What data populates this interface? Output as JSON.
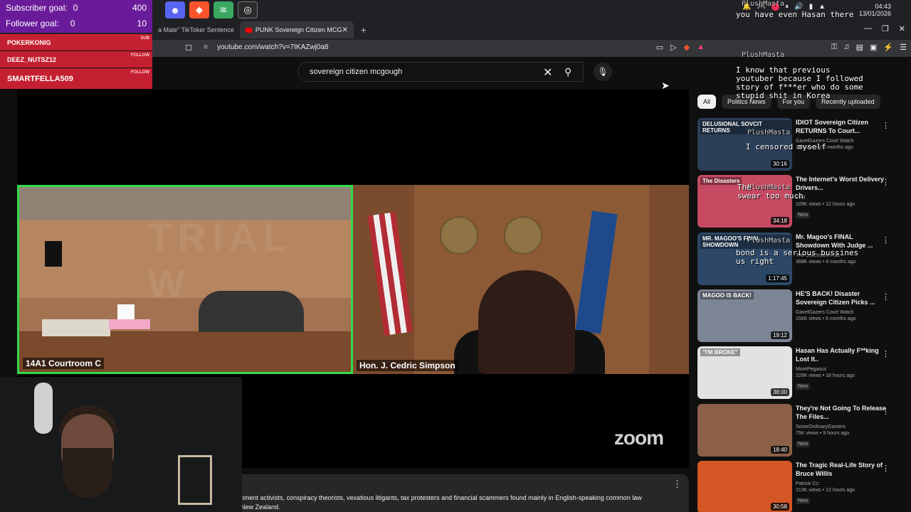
{
  "stream": {
    "goals": [
      {
        "label": "Subscriber goal:",
        "current": "0",
        "target": "400"
      },
      {
        "label": "Follower goal:",
        "current": "0",
        "target": "10"
      }
    ],
    "alerts": [
      {
        "name": "POKERKONIG",
        "tag": "SUB"
      },
      {
        "name": "DEEZ_NUTSZ12",
        "tag": "FOLLOW"
      },
      {
        "name": "SMARTFELLA509",
        "tag": "FOLLOW"
      }
    ],
    "chat": [
      {
        "user": "PlushMasta",
        "msg": "you have even Hasan there"
      },
      {
        "user": "PlushMasta",
        "msg": "I know that previous\nyoutuber because I followed\nstory of f***er who do some\nstupid shit in Korea"
      },
      {
        "user": "PlushMasta",
        "msg": "I censored myself"
      },
      {
        "user": "PlushMasta",
        "msg": "The\nswear too much"
      },
      {
        "user": "PlushMasta",
        "msg": "bond is a serious bussines\nus right"
      }
    ]
  },
  "browser": {
    "tabs": [
      {
        "label": "a Male\" TikToker Sentence"
      },
      {
        "label": "PUNK Sovereign Citizen MCG"
      }
    ],
    "new_tab": "+",
    "tab_close": "✕",
    "url_prefix": "≡",
    "url": "youtube.com/watch?v=7IKAZwj0a8",
    "window_controls": [
      "—",
      "❐",
      "✕"
    ],
    "clock": {
      "time": "04:43",
      "date": "13/01/2026"
    }
  },
  "youtube": {
    "search_query": "sovereign citizen mcgough",
    "clear_label": "✕",
    "search_icon": "⚲",
    "mic_icon": "🎙",
    "player": {
      "left_caption": "14A1 Courtroom C",
      "right_caption": "Hon. J. Cedric Simpson",
      "watermark": "TRIAL W",
      "brand": "zoom"
    },
    "description": "nment activists, conspiracy theorists, vexatious litigants, tax protesters and financial scammers found mainly in English-speaking common law\nNew Zealand.",
    "description_more": "⋮",
    "chips": [
      "All",
      "Politics News",
      "For you",
      "Recently uploaded"
    ],
    "active_chip": 0,
    "recommendations": [
      {
        "title": "IDIOT Sovereign Citizen RETURNS To Court...",
        "channel": "GavelGazers Court Watch",
        "meta": "16K views • 4 months ago",
        "duration": "30:16",
        "badge": "",
        "thumb_caption": "DELUSIONAL SOVCIT RETURNS",
        "color": "#2b3f59"
      },
      {
        "title": "The Internet's Worst Delivery Drivers...",
        "channel": "Zmil",
        "meta": "109K views • 12 hours ago",
        "duration": "34:18",
        "badge": "New",
        "thumb_caption": "The Disasters",
        "color": "#c54a62"
      },
      {
        "title": "Mr. Magoo's FINAL Showdown With Judge ...",
        "channel": "The Courtroom Hub",
        "meta": "368K views • 4 months ago",
        "duration": "1:17:45",
        "badge": "",
        "thumb_caption": "MR. MAGOO'S FINAL SHOWDOWN",
        "color": "#2d4867"
      },
      {
        "title": "HE'S BACK! Disaster Sovereign Citizen Picks ...",
        "channel": "GavelGazers Court Watch",
        "meta": "156K views • 6 months ago",
        "duration": "19:12",
        "badge": "",
        "thumb_caption": "MAGOO IS BACK!",
        "color": "#7b8594"
      },
      {
        "title": "Hasan Has Actually F**king Lost It..",
        "channel": "MorePegasus",
        "meta": "226K views • 18 hours ago",
        "duration": "38:00",
        "badge": "New",
        "thumb_caption": "\"I'M BROKE\"",
        "color": "#e2e2e2"
      },
      {
        "title": "They're Not Going To Release The Files...",
        "channel": "SomeOrdinaryGamers",
        "meta": "75K views • 9 hours ago",
        "duration": "18:40",
        "badge": "New",
        "thumb_caption": "",
        "color": "#8c6048"
      },
      {
        "title": "The Tragic Real-Life Story of Bruce Willis",
        "channel": "Patrick Cc:",
        "meta": "213K views • 12 hours ago",
        "duration": "30:58",
        "badge": "New",
        "thumb_caption": "",
        "color": "#d35624"
      }
    ]
  }
}
